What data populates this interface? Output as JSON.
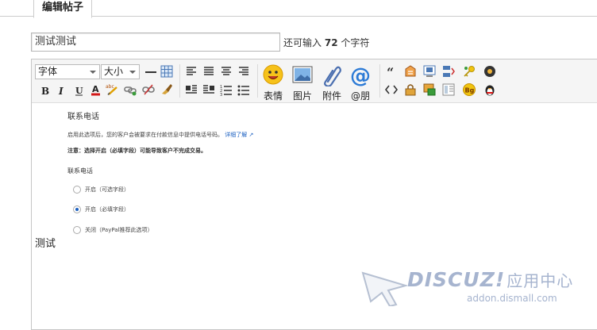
{
  "tab": {
    "label": "编辑帖子"
  },
  "subject": {
    "value": "测试测试"
  },
  "remaining": {
    "prefix": "还可输入",
    "count": "72",
    "suffix": "个字符"
  },
  "toolbar": {
    "font_label": "字体",
    "size_label": "大小",
    "emoji_label": "表情",
    "image_label": "图片",
    "attach_label": "附件",
    "at_label": "@朋",
    "bg_label": "Bg"
  },
  "content": {
    "heading": "联系电话",
    "desc": "启用此选项后，您的客户会被要求在付款信息中提供电话号码。",
    "learn_more": "详细了解",
    "note": "注意：选择开启（必填字段）可能导致客户不完成交易。",
    "sub_heading": "联系电话",
    "options": [
      {
        "label": "开启（可选字段）",
        "checked": false
      },
      {
        "label": "开启（必填字段）",
        "checked": true
      },
      {
        "label": "关闭（PayPal推荐此选项）",
        "checked": false
      }
    ],
    "body_text": "测试"
  },
  "watermark": {
    "brand": "DISCUZ!",
    "cn": "应用中心",
    "url": "addon.dismall.com"
  },
  "colors": {
    "accent": "#1a5fc0",
    "watermark": "#9aa9c4"
  }
}
